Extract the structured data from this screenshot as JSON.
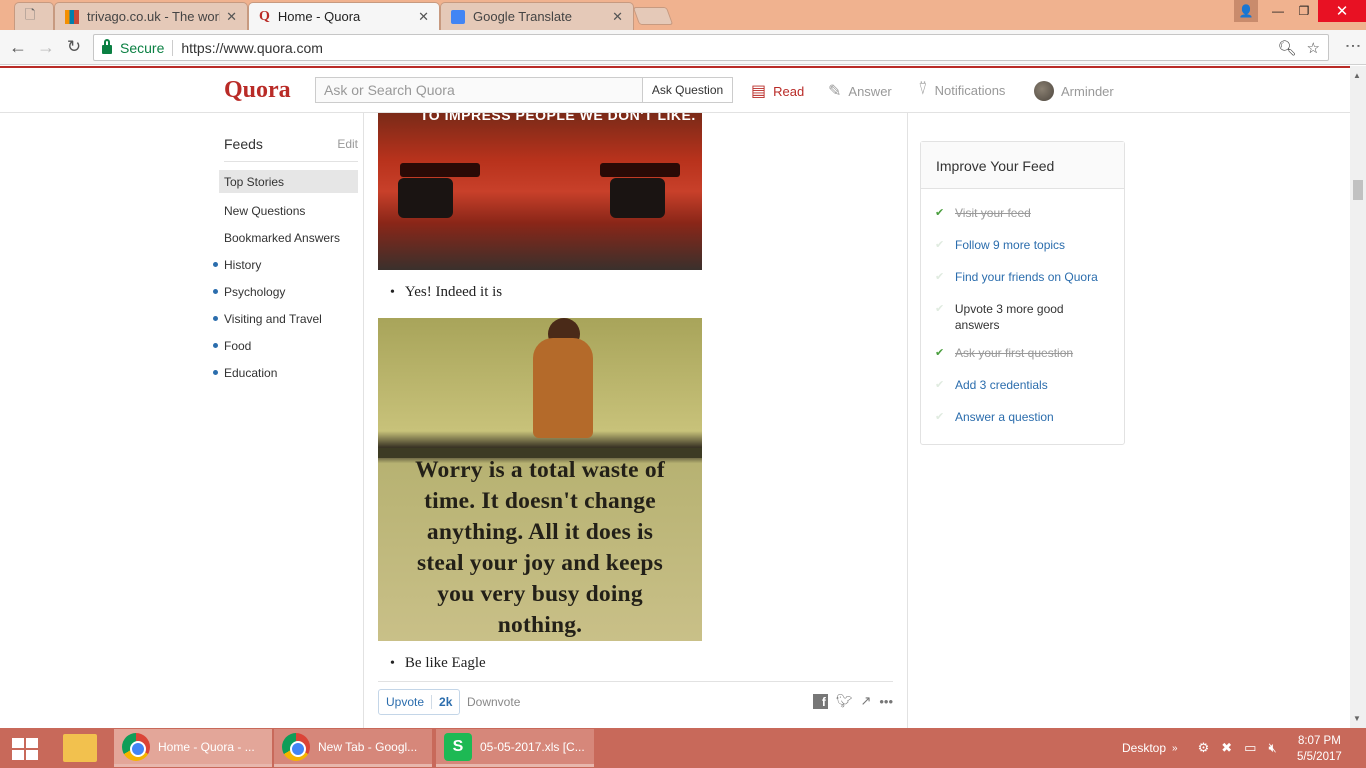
{
  "browser": {
    "tabs": [
      {
        "title": "",
        "active": false
      },
      {
        "title": "trivago.co.uk - The world",
        "active": false
      },
      {
        "title": "Home - Quora",
        "active": true
      },
      {
        "title": "Google Translate",
        "active": false
      }
    ],
    "close_glyph": "✕",
    "secure_label": "Secure",
    "url": "https://www.quora.com"
  },
  "quora": {
    "logo": "Quora",
    "search_placeholder": "Ask or Search Quora",
    "ask_button": "Ask Question",
    "nav": {
      "read": "Read",
      "answer": "Answer",
      "notifications": "Notifications",
      "user": "Arminder"
    },
    "accent": "#b92b27",
    "link_color": "#2b6dad"
  },
  "sidebar": {
    "title": "Feeds",
    "edit": "Edit",
    "items": [
      {
        "label": "Top Stories"
      },
      {
        "label": "New Questions"
      },
      {
        "label": "Bookmarked Answers"
      }
    ],
    "topics": [
      {
        "label": "History"
      },
      {
        "label": "Psychology"
      },
      {
        "label": "Visiting and Travel"
      },
      {
        "label": "Food"
      },
      {
        "label": "Education"
      }
    ]
  },
  "feed": {
    "car_image_text": "TO IMPRESS PEOPLE WE DON'T LIKE.",
    "bullet1": "Yes! Indeed it is",
    "quote_lines": [
      "Worry is a total waste of",
      "time. It doesn't change",
      "anything. All it does is",
      "steal your joy and keeps",
      "you very busy doing",
      "nothing."
    ],
    "bullet2": "Be like Eagle",
    "upvote_label": "Upvote",
    "upvote_count": "2k",
    "downvote_label": "Downvote"
  },
  "improve_feed": {
    "title": "Improve Your Feed",
    "items": [
      {
        "label": "Visit your feed",
        "status": "done"
      },
      {
        "label": "Follow 9 more topics",
        "status": "link"
      },
      {
        "label": "Find your friends on Quora",
        "status": "link"
      },
      {
        "label": "Upvote 3 more good answers",
        "status": "plain"
      },
      {
        "label": "Ask your first question",
        "status": "done"
      },
      {
        "label": "Add 3 credentials",
        "status": "link"
      },
      {
        "label": "Answer a question",
        "status": "link"
      }
    ]
  },
  "taskbar": {
    "tasks": [
      {
        "label": "Home - Quora - ...",
        "icon": "chrome-icon",
        "active": true
      },
      {
        "label": "New Tab - Googl...",
        "icon": "chrome-icon",
        "active": false
      },
      {
        "label": "05-05-2017.xls [C...",
        "icon": "spreadsheet-icon",
        "active": false
      }
    ],
    "desktop_label": "Desktop",
    "time": "8:07 PM",
    "date": "5/5/2017"
  }
}
